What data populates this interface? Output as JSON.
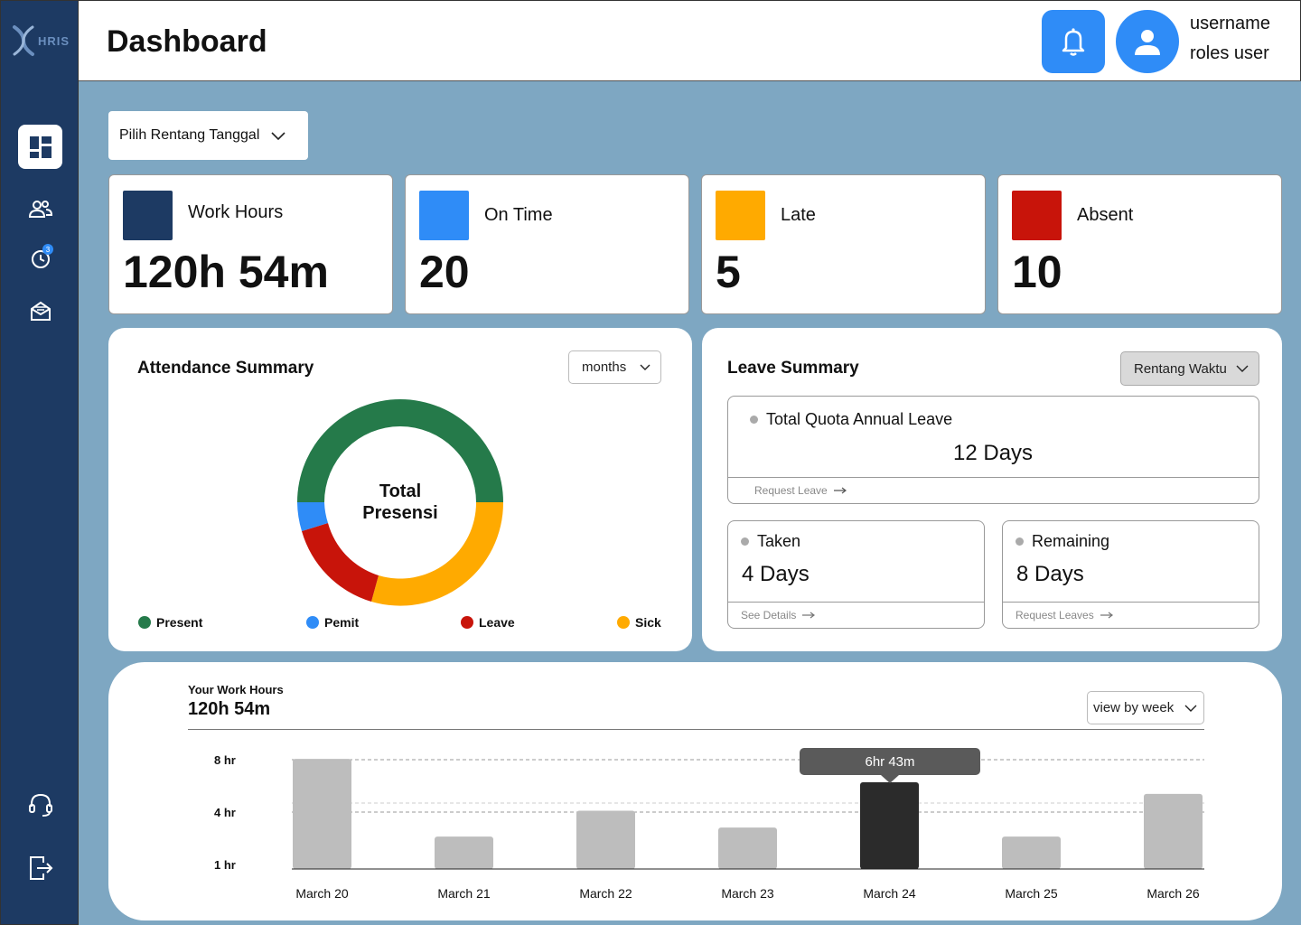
{
  "app": {
    "logo_text": "HRIS"
  },
  "sidebar": {
    "items": [
      {
        "icon": "dashboard-icon",
        "active": true
      },
      {
        "icon": "users-icon"
      },
      {
        "icon": "clock-icon",
        "badge": "3"
      },
      {
        "icon": "mail-icon"
      },
      {
        "icon": "headset-icon"
      },
      {
        "icon": "logout-icon"
      }
    ]
  },
  "header": {
    "title": "Dashboard",
    "user": {
      "name": "username",
      "role": "roles user"
    }
  },
  "filter": {
    "date_range_label": "Pilih Rentang Tanggal"
  },
  "stats": [
    {
      "label": "Work Hours",
      "value": "120h 54m",
      "color": "#1d3a63"
    },
    {
      "label": "On Time",
      "value": "20",
      "color": "#2f8cf7"
    },
    {
      "label": "Late",
      "value": "5",
      "color": "#ffaa00"
    },
    {
      "label": "Absent",
      "value": "10",
      "color": "#c8140a"
    }
  ],
  "attendance": {
    "title": "Attendance Summary",
    "period": "months",
    "center_line1": "Total",
    "center_line2": "Presensi",
    "legend": [
      {
        "label": "Present",
        "color": "#257a4a"
      },
      {
        "label": "Pemit",
        "color": "#2f8cf7"
      },
      {
        "label": "Leave",
        "color": "#c8140a"
      },
      {
        "label": "Sick",
        "color": "#ffaa00"
      }
    ]
  },
  "leave": {
    "title": "Leave Summary",
    "range": "Rentang Waktu",
    "quota_label": "Total Quota Annual Leave",
    "quota_value": "12 Days",
    "quota_link": "Request Leave",
    "taken_label": "Taken",
    "taken_value": "4 Days",
    "taken_link": "See Details",
    "remaining_label": "Remaining",
    "remaining_value": "8 Days",
    "remaining_link": "Request Leaves"
  },
  "work_hours": {
    "label": "Your Work Hours",
    "total": "120h 54m",
    "view": "view by week",
    "tooltip": "6hr 43m"
  },
  "chart_data": {
    "type": "bar",
    "categories": [
      "March 20",
      "March 21",
      "March 22",
      "March 23",
      "March 24",
      "March 25",
      "March 26"
    ],
    "values": [
      8.5,
      2.5,
      4.5,
      3.2,
      6.7,
      2.5,
      5.8
    ],
    "highlight": "March 24",
    "ytick_labels": [
      "8 hr",
      "4 hr",
      "1 hr"
    ],
    "grid": true,
    "colors": {
      "bar": "#bdbdbd",
      "highlight": "#2b2b2b"
    }
  }
}
